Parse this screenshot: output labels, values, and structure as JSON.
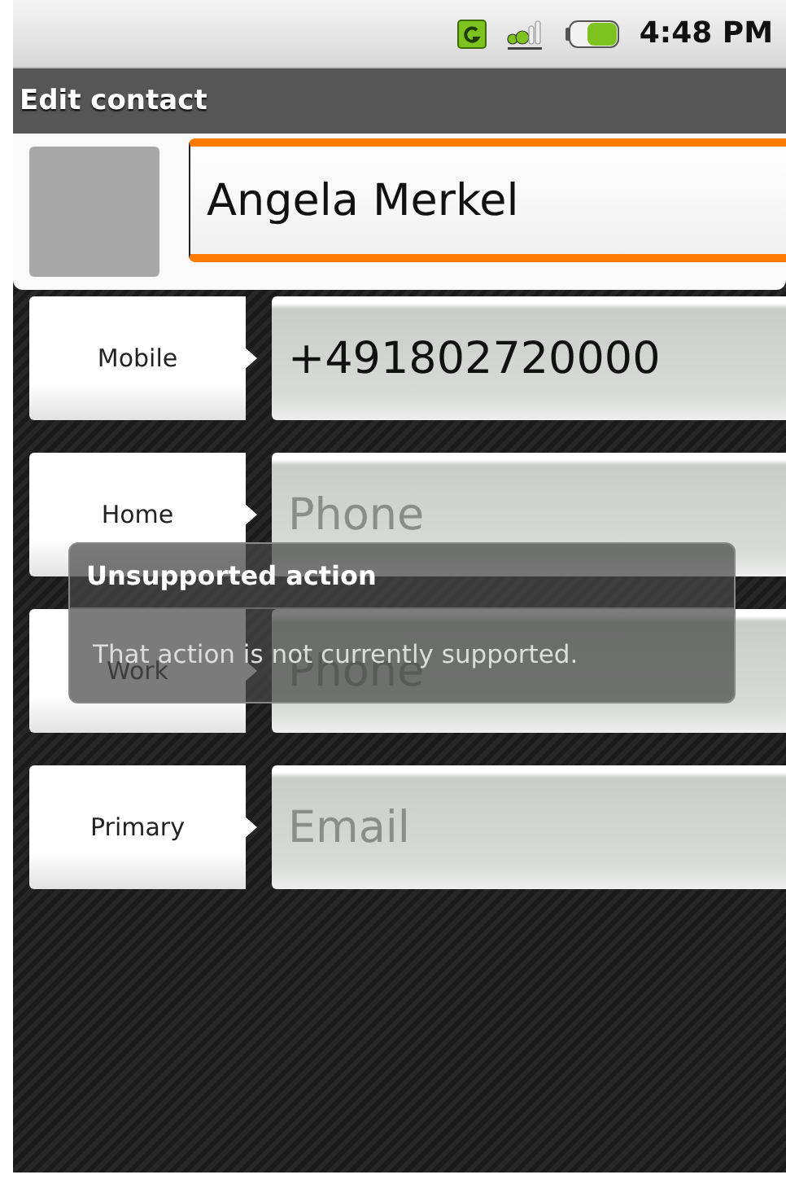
{
  "status_bar": {
    "time": "4:48 PM"
  },
  "title_bar": {
    "title": "Edit contact"
  },
  "contact": {
    "name": "Angela Merkel",
    "focused": true
  },
  "fields": [
    {
      "label": "Mobile",
      "value": "+491802720000"
    },
    {
      "label": "Home",
      "placeholder": "Phone"
    },
    {
      "label": "Work",
      "placeholder": "Phone"
    },
    {
      "label": "Primary",
      "placeholder": "Email"
    }
  ],
  "toast": {
    "title": "Unsupported action",
    "message": "That action is not currently supported."
  }
}
